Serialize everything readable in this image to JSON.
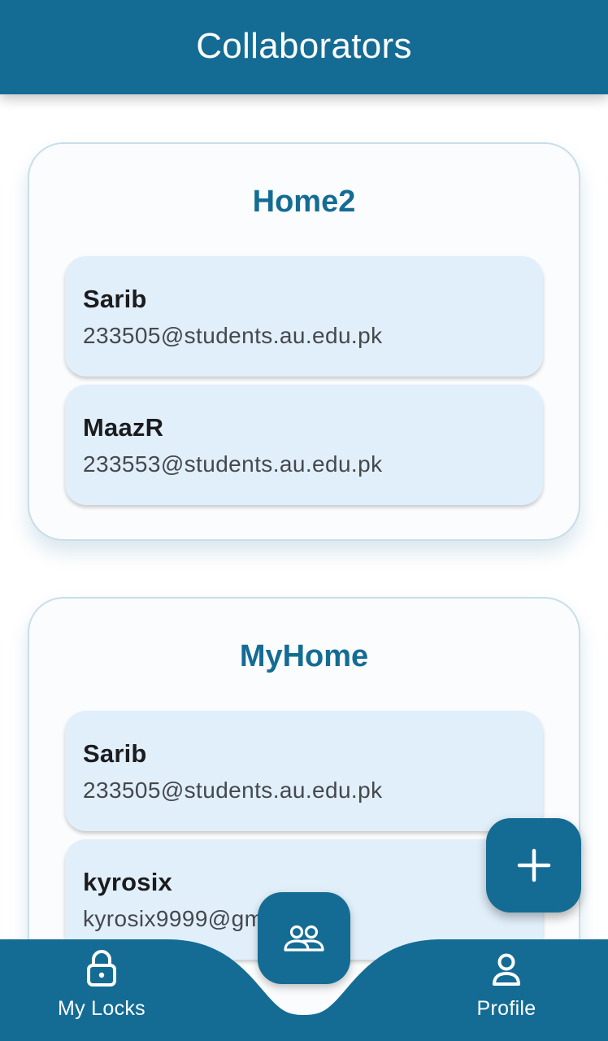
{
  "app_bar": {
    "title": "Collaborators"
  },
  "groups": [
    {
      "name": "Home2",
      "members": [
        {
          "name": "Sarib",
          "email": "233505@students.au.edu.pk"
        },
        {
          "name": "MaazR",
          "email": "233553@students.au.edu.pk"
        }
      ]
    },
    {
      "name": "MyHome",
      "members": [
        {
          "name": "Sarib",
          "email": "233505@students.au.edu.pk"
        },
        {
          "name": "kyrosix",
          "email": "kyrosix9999@gm"
        }
      ]
    }
  ],
  "fab": {
    "icon": "plus-icon"
  },
  "bottom_nav": {
    "left": {
      "label": "My Locks",
      "icon": "lock-icon"
    },
    "center": {
      "icon": "people-icon"
    },
    "right": {
      "label": "Profile",
      "icon": "person-icon"
    }
  },
  "colors": {
    "primary": "#146c94",
    "member_card_bg": "#e1effb",
    "group_card_border": "#c8dee9"
  }
}
